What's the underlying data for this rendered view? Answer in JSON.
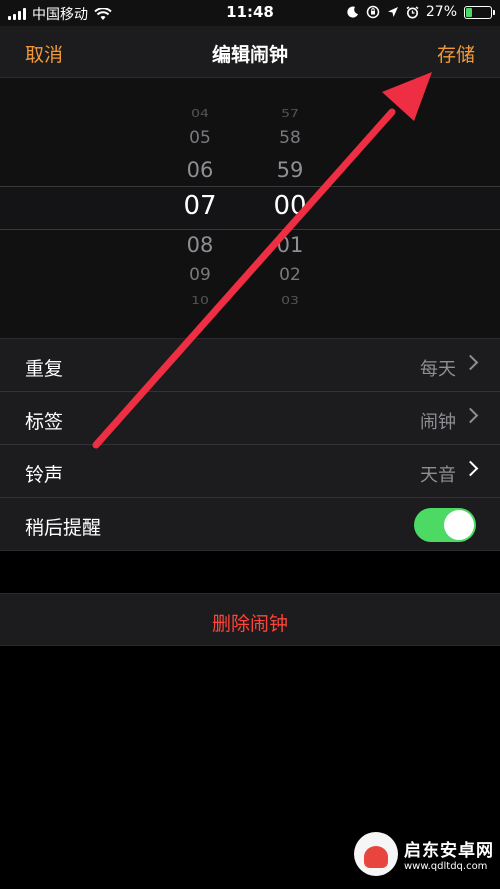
{
  "status_bar": {
    "carrier": "中国移动",
    "time": "11:48",
    "battery": "27%",
    "battery_level": 0.27
  },
  "nav": {
    "cancel_label": "取消",
    "title": "编辑闹钟",
    "save_label": "存储"
  },
  "picker": {
    "hours": [
      "04",
      "05",
      "06",
      "07",
      "08",
      "09",
      "10"
    ],
    "minutes": [
      "57",
      "58",
      "59",
      "00",
      "01",
      "02",
      "03"
    ],
    "selected_hour": "07",
    "selected_minute": "00"
  },
  "settings": {
    "repeat_label": "重复",
    "repeat_value": "每天",
    "label_label": "标签",
    "label_value": "闹钟",
    "sound_label": "铃声",
    "sound_value": "天音",
    "snooze_label": "稍后提醒",
    "snooze_on": true
  },
  "delete_label": "删除闹钟",
  "watermark": {
    "title": "启东安卓网",
    "url": "www.qdltdq.com"
  },
  "colors": {
    "accent": "#f09a37",
    "destructive": "#ff453a",
    "toggle_on": "#4cd964",
    "annotation_arrow": "#ee2f43"
  }
}
